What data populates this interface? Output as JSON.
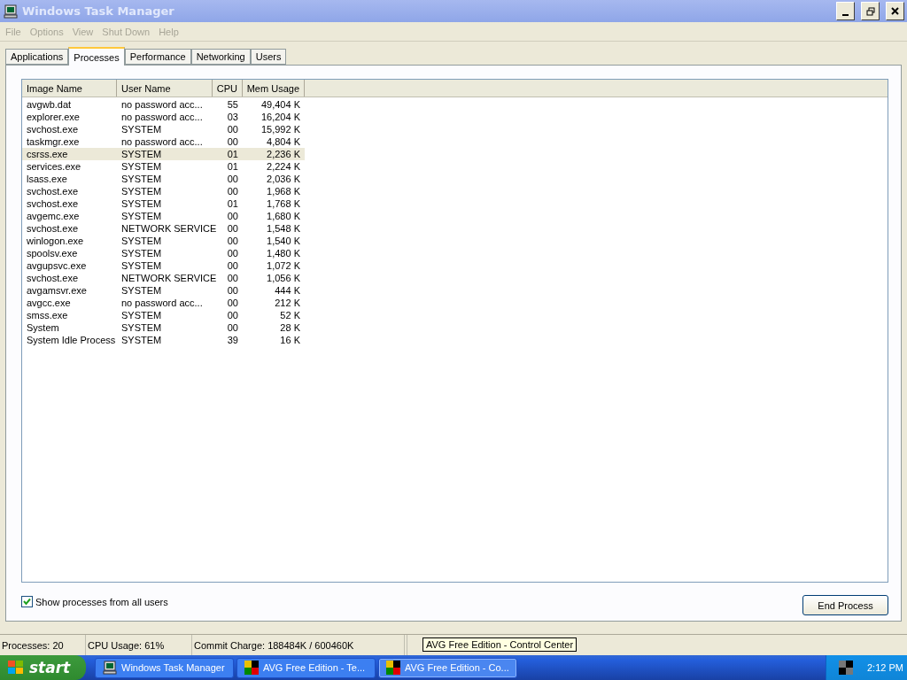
{
  "window": {
    "title": "Windows Task Manager"
  },
  "menu": [
    "File",
    "Options",
    "View",
    "Shut Down",
    "Help"
  ],
  "tabs": [
    {
      "label": "Applications",
      "selected": false
    },
    {
      "label": "Processes",
      "selected": true
    },
    {
      "label": "Performance",
      "selected": false
    },
    {
      "label": "Networking",
      "selected": false
    },
    {
      "label": "Users",
      "selected": false
    }
  ],
  "table": {
    "columns": [
      "Image Name",
      "User Name",
      "CPU",
      "Mem Usage"
    ],
    "rows": [
      {
        "cells": [
          "avgwb.dat",
          "no password acc...",
          "55",
          "49,404 K"
        ],
        "selected": false
      },
      {
        "cells": [
          "explorer.exe",
          "no password acc...",
          "03",
          "16,204 K"
        ],
        "selected": false
      },
      {
        "cells": [
          "svchost.exe",
          "SYSTEM",
          "00",
          "15,992 K"
        ],
        "selected": false
      },
      {
        "cells": [
          "taskmgr.exe",
          "no password acc...",
          "00",
          "4,804 K"
        ],
        "selected": false
      },
      {
        "cells": [
          "csrss.exe",
          "SYSTEM",
          "01",
          "2,236 K"
        ],
        "selected": true
      },
      {
        "cells": [
          "services.exe",
          "SYSTEM",
          "01",
          "2,224 K"
        ],
        "selected": false
      },
      {
        "cells": [
          "lsass.exe",
          "SYSTEM",
          "00",
          "2,036 K"
        ],
        "selected": false
      },
      {
        "cells": [
          "svchost.exe",
          "SYSTEM",
          "00",
          "1,968 K"
        ],
        "selected": false
      },
      {
        "cells": [
          "svchost.exe",
          "SYSTEM",
          "01",
          "1,768 K"
        ],
        "selected": false
      },
      {
        "cells": [
          "avgemc.exe",
          "SYSTEM",
          "00",
          "1,680 K"
        ],
        "selected": false
      },
      {
        "cells": [
          "svchost.exe",
          "NETWORK SERVICE",
          "00",
          "1,548 K"
        ],
        "selected": false
      },
      {
        "cells": [
          "winlogon.exe",
          "SYSTEM",
          "00",
          "1,540 K"
        ],
        "selected": false
      },
      {
        "cells": [
          "spoolsv.exe",
          "SYSTEM",
          "00",
          "1,480 K"
        ],
        "selected": false
      },
      {
        "cells": [
          "avgupsvc.exe",
          "SYSTEM",
          "00",
          "1,072 K"
        ],
        "selected": false
      },
      {
        "cells": [
          "svchost.exe",
          "NETWORK SERVICE",
          "00",
          "1,056 K"
        ],
        "selected": false
      },
      {
        "cells": [
          "avgamsvr.exe",
          "SYSTEM",
          "00",
          "444 K"
        ],
        "selected": false
      },
      {
        "cells": [
          "avgcc.exe",
          "no password acc...",
          "00",
          "212 K"
        ],
        "selected": false
      },
      {
        "cells": [
          "smss.exe",
          "SYSTEM",
          "00",
          "52 K"
        ],
        "selected": false
      },
      {
        "cells": [
          "System",
          "SYSTEM",
          "00",
          "28 K"
        ],
        "selected": false
      },
      {
        "cells": [
          "System Idle Process",
          "SYSTEM",
          "39",
          "16 K"
        ],
        "selected": false
      }
    ]
  },
  "show_all_users": {
    "label": "Show processes from all users",
    "checked": true
  },
  "end_process_button": "End Process",
  "status_bar": [
    "Processes: 20",
    "CPU Usage: 61%",
    "Commit Charge: 188484K / 600460K"
  ],
  "tooltip": "AVG Free Edition - Control Center",
  "taskbar": {
    "start": "start",
    "buttons": [
      {
        "label": "Windows Task Manager",
        "kind": "monitor",
        "selected": false
      },
      {
        "label": "AVG Free Edition - Te...",
        "kind": "avg",
        "selected": false
      },
      {
        "label": "AVG Free Edition - Co...",
        "kind": "avg",
        "selected": true
      }
    ],
    "clock": "2:12 PM"
  }
}
